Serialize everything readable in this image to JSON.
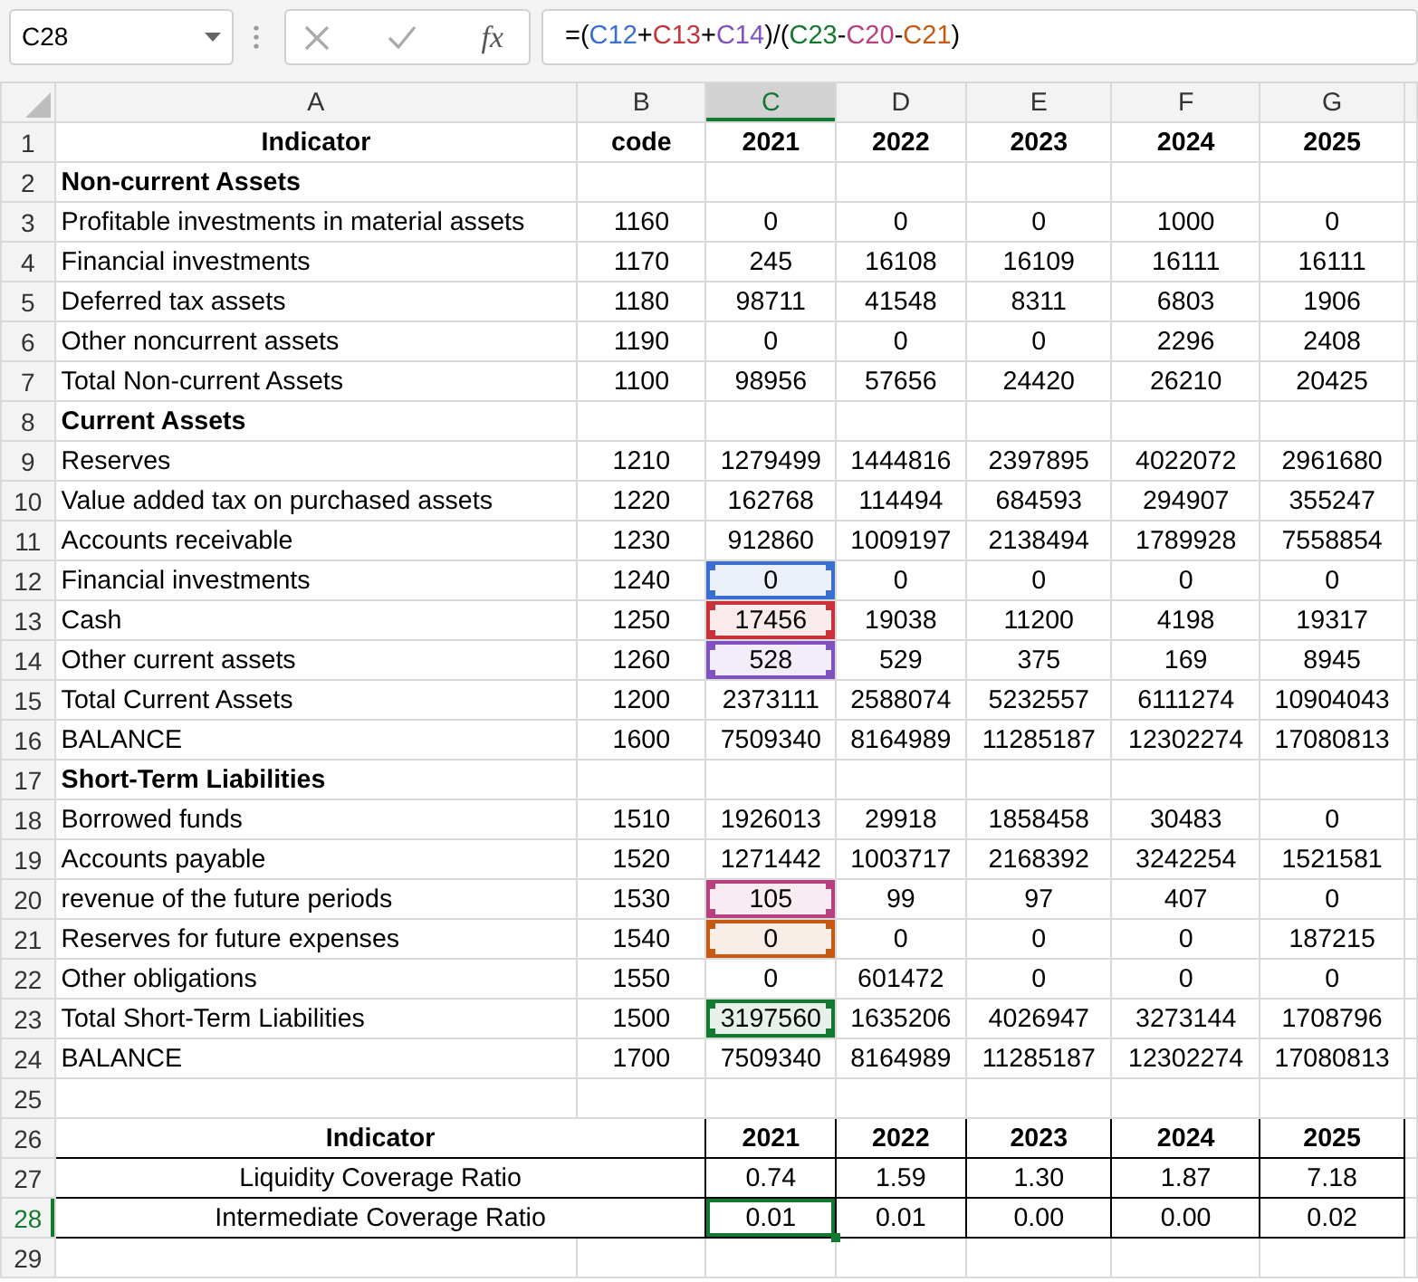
{
  "name_box": "C28",
  "function_label": "fx",
  "formula": [
    {
      "text": "=("
    },
    {
      "text": "C12",
      "color": "#3a6fd0"
    },
    {
      "text": "+"
    },
    {
      "text": "C13",
      "color": "#c8323a"
    },
    {
      "text": "+"
    },
    {
      "text": "C14",
      "color": "#8052c0"
    },
    {
      "text": ")/("
    },
    {
      "text": "C23",
      "color": "#127a30"
    },
    {
      "text": "-"
    },
    {
      "text": "C20",
      "color": "#b8407e"
    },
    {
      "text": "-"
    },
    {
      "text": "C21",
      "color": "#c55a11"
    },
    {
      "text": ")"
    }
  ],
  "columns": [
    {
      "label": "A",
      "selected": false
    },
    {
      "label": "B",
      "selected": false
    },
    {
      "label": "C",
      "selected": true
    },
    {
      "label": "D",
      "selected": false
    },
    {
      "label": "E",
      "selected": false
    },
    {
      "label": "F",
      "selected": false
    },
    {
      "label": "G",
      "selected": false
    }
  ],
  "rows": [
    {
      "number": "1",
      "selected": false,
      "kind": "header",
      "cells": [
        "Indicator",
        "code",
        "2021",
        "2022",
        "2023",
        "2024",
        "2025"
      ]
    },
    {
      "number": "2",
      "selected": false,
      "kind": "section",
      "cells": [
        "Non-current Assets"
      ]
    },
    {
      "number": "3",
      "selected": false,
      "kind": "data",
      "cells": [
        "Profitable investments in material assets",
        "1160",
        "0",
        "0",
        "0",
        "1000",
        "0"
      ]
    },
    {
      "number": "4",
      "selected": false,
      "kind": "data",
      "cells": [
        "Financial investments",
        "1170",
        "245",
        "16108",
        "16109",
        "16111",
        "16111"
      ]
    },
    {
      "number": "5",
      "selected": false,
      "kind": "data",
      "cells": [
        "Deferred tax assets",
        "1180",
        "98711",
        "41548",
        "8311",
        "6803",
        "1906"
      ]
    },
    {
      "number": "6",
      "selected": false,
      "kind": "data",
      "cells": [
        "Other noncurrent assets",
        "1190",
        "0",
        "0",
        "0",
        "2296",
        "2408"
      ]
    },
    {
      "number": "7",
      "selected": false,
      "kind": "data",
      "cells": [
        "Total Non-current Assets",
        "1100",
        "98956",
        "57656",
        "24420",
        "26210",
        "20425"
      ]
    },
    {
      "number": "8",
      "selected": false,
      "kind": "section",
      "cells": [
        "Current Assets"
      ]
    },
    {
      "number": "9",
      "selected": false,
      "kind": "data",
      "cells": [
        "Reserves",
        "1210",
        "1279499",
        "1444816",
        "2397895",
        "4022072",
        "2961680"
      ]
    },
    {
      "number": "10",
      "selected": false,
      "kind": "data",
      "cells": [
        "Value added tax on purchased assets",
        "1220",
        "162768",
        "114494",
        "684593",
        "294907",
        "355247"
      ]
    },
    {
      "number": "11",
      "selected": false,
      "kind": "data",
      "cells": [
        "Accounts receivable",
        "1230",
        "912860",
        "1009197",
        "2138494",
        "1789928",
        "7558854"
      ]
    },
    {
      "number": "12",
      "selected": false,
      "kind": "data",
      "color": "#3a6fd0",
      "cells": [
        "Financial investments",
        "1240",
        "0",
        "0",
        "0",
        "0",
        "0"
      ]
    },
    {
      "number": "13",
      "selected": false,
      "kind": "data",
      "color": "#c8323a",
      "cells": [
        "Cash",
        "1250",
        "17456",
        "19038",
        "11200",
        "4198",
        "19317"
      ]
    },
    {
      "number": "14",
      "selected": false,
      "kind": "data",
      "color": "#8052c0",
      "cells": [
        "Other current assets",
        "1260",
        "528",
        "529",
        "375",
        "169",
        "8945"
      ]
    },
    {
      "number": "15",
      "selected": false,
      "kind": "data",
      "cells": [
        "Total Current Assets",
        "1200",
        "2373111",
        "2588074",
        "5232557",
        "6111274",
        "10904043"
      ]
    },
    {
      "number": "16",
      "selected": false,
      "kind": "data",
      "cells": [
        "BALANCE",
        "1600",
        "7509340",
        "8164989",
        "11285187",
        "12302274",
        "17080813"
      ]
    },
    {
      "number": "17",
      "selected": false,
      "kind": "section",
      "cells": [
        "Short-Term Liabilities"
      ]
    },
    {
      "number": "18",
      "selected": false,
      "kind": "data",
      "cells": [
        "Borrowed funds",
        "1510",
        "1926013",
        "29918",
        "1858458",
        "30483",
        "0"
      ]
    },
    {
      "number": "19",
      "selected": false,
      "kind": "data",
      "cells": [
        "Accounts payable",
        "1520",
        "1271442",
        "1003717",
        "2168392",
        "3242254",
        "1521581"
      ]
    },
    {
      "number": "20",
      "selected": false,
      "kind": "data",
      "color": "#b8407e",
      "cells": [
        "revenue of the future periods",
        "1530",
        "105",
        "99",
        "97",
        "407",
        "0"
      ]
    },
    {
      "number": "21",
      "selected": false,
      "kind": "data",
      "color": "#c55a11",
      "cells": [
        "Reserves for future expenses",
        "1540",
        "0",
        "0",
        "0",
        "0",
        "187215"
      ]
    },
    {
      "number": "22",
      "selected": false,
      "kind": "data",
      "cells": [
        "Other obligations",
        "1550",
        "0",
        "601472",
        "0",
        "0",
        "0"
      ]
    },
    {
      "number": "23",
      "selected": false,
      "kind": "data",
      "color": "#127a30",
      "cells": [
        "Total Short-Term Liabilities",
        "1500",
        "3197560",
        "1635206",
        "4026947",
        "3273144",
        "1708796"
      ]
    },
    {
      "number": "24",
      "selected": false,
      "kind": "data",
      "cells": [
        "BALANCE",
        "1700",
        "7509340",
        "8164989",
        "11285187",
        "12302274",
        "17080813"
      ]
    },
    {
      "number": "25",
      "selected": false,
      "kind": "empty",
      "cells": []
    },
    {
      "number": "26",
      "selected": false,
      "kind": "ratio_header",
      "cells": [
        "Indicator",
        "2021",
        "2022",
        "2023",
        "2024",
        "2025"
      ]
    },
    {
      "number": "27",
      "selected": false,
      "kind": "ratio",
      "cells": [
        "Liquidity Coverage Ratio",
        "0.74",
        "1.59",
        "1.30",
        "1.87",
        "7.18"
      ]
    },
    {
      "number": "28",
      "selected": true,
      "kind": "ratio",
      "cells": [
        "Intermediate Coverage Ratio",
        "0.01",
        "0.01",
        "0.00",
        "0.00",
        "0.02"
      ]
    },
    {
      "number": "29",
      "selected": false,
      "kind": "empty",
      "cells": []
    }
  ]
}
